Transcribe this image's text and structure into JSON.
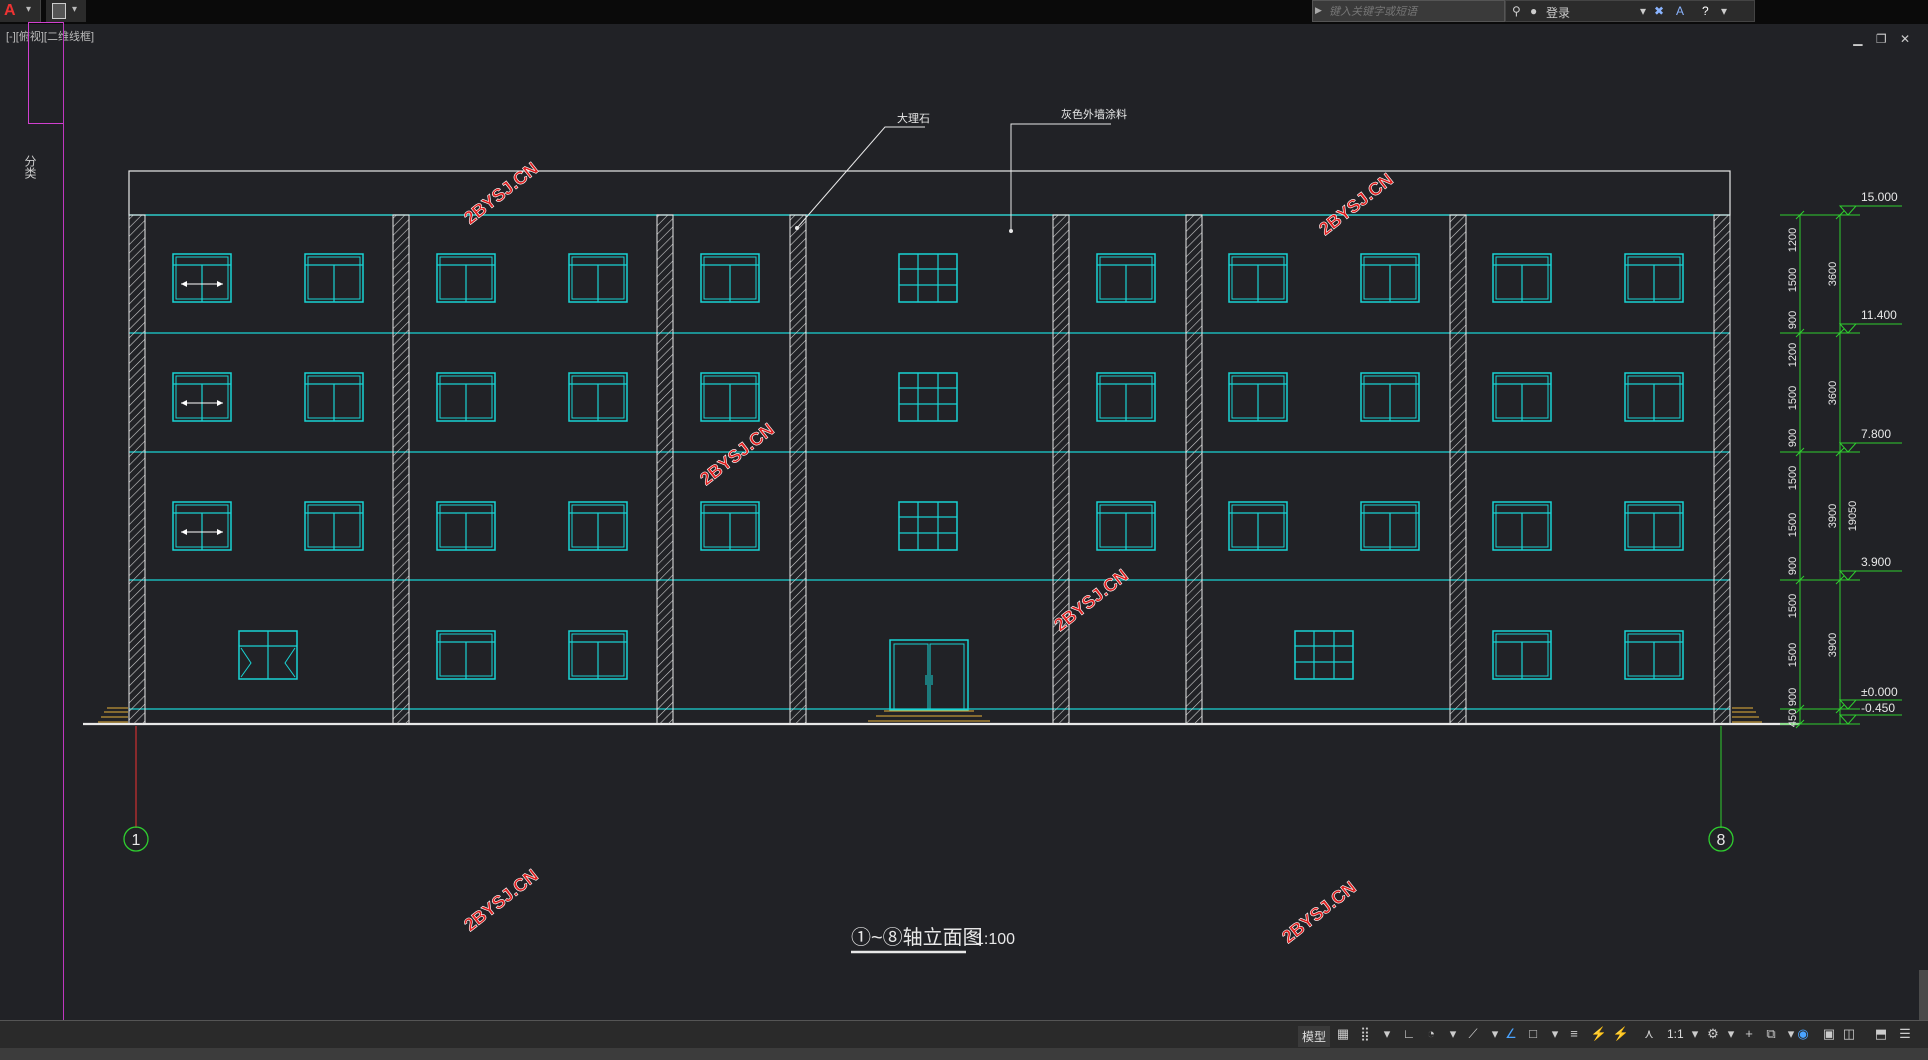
{
  "app": {
    "search_placeholder": "键入关键字或短语",
    "login_label": "登录",
    "viewport_label": "[-][俯视][二维线框]",
    "side_text": "分类"
  },
  "drawing": {
    "title": "①~⑧轴立面图",
    "scale": "1:100",
    "watermark": "2BYSJ.CN",
    "callouts": [
      "大理石",
      "灰色外墙涂料"
    ],
    "elevations": [
      "15.000",
      "11.400",
      "7.800",
      "3.900",
      "±0.000",
      "-0.450"
    ],
    "dims_inner": [
      "1200",
      "1500",
      "900",
      "1200",
      "1500",
      "900",
      "1500",
      "1500",
      "900",
      "1500",
      "1500",
      "900",
      "450"
    ],
    "dims_floor": [
      "3600",
      "3600",
      "3900",
      "3900"
    ],
    "dim_total": "19050",
    "axis_left": "1",
    "axis_right": "8"
  },
  "statusbar": {
    "model_label": "模型",
    "scale_label": "1:1"
  },
  "colors": {
    "background": "#212226",
    "windows": "#19d3d3",
    "outline": "#e8e8e8",
    "dims": "#2fcf2f",
    "watermark": "#e02020",
    "axis": "#2fcf2f"
  }
}
